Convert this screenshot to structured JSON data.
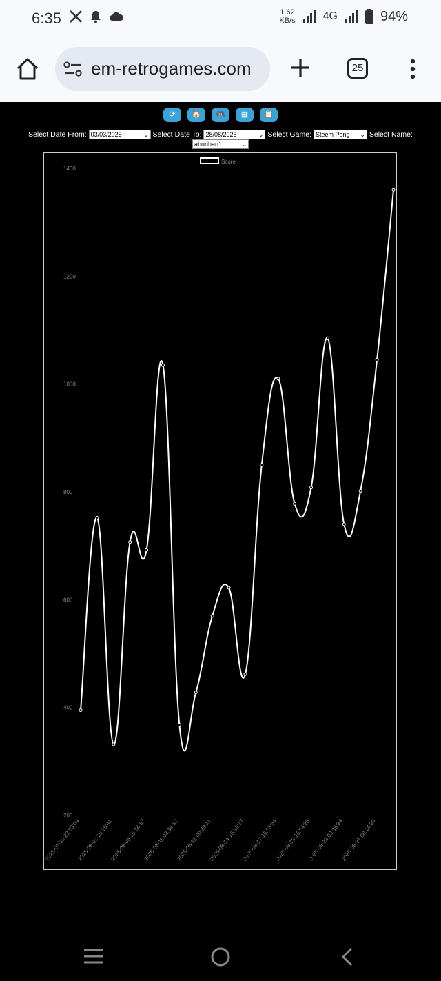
{
  "status_bar": {
    "time": "6:35",
    "net_speed": "1.62",
    "net_unit": "KB/s",
    "network": "4G",
    "battery": "94%"
  },
  "browser": {
    "url": "em-retrogames.com",
    "tab_count": "25"
  },
  "nav_buttons": [
    {
      "icon": "refresh-icon",
      "glyph": "⟳"
    },
    {
      "icon": "home-icon",
      "glyph": "🏠"
    },
    {
      "icon": "gamepad-icon",
      "glyph": "🎮"
    },
    {
      "icon": "grid-icon",
      "glyph": "▦"
    },
    {
      "icon": "clipboard-icon",
      "glyph": "📋"
    }
  ],
  "filters": {
    "date_from_label": "Select Date From:",
    "date_from_value": "03/03/2025",
    "date_to_label": "Select Date To:",
    "date_to_value": "28/08/2025",
    "game_label": "Select Game:",
    "game_value": "Steem Pong",
    "name_label": "Select Name:",
    "name_value": "aburihan1"
  },
  "colors": {
    "button": "#3aa3d8",
    "line": "#ffffff",
    "background": "#000000"
  },
  "chart_data": {
    "type": "line",
    "legend": "Score",
    "ylim": [
      200,
      1400
    ],
    "yticks": [
      200,
      400,
      600,
      800,
      1000,
      1200,
      1400
    ],
    "xticks": [
      "2025-07-30 22:53:04",
      "2025-08-02 15:15:41",
      "2025-08-05 15:24:57",
      "2025-08-11 02:34:52",
      "2025-08-12 00:29:11",
      "2025-08-14 15:12:17",
      "2025-08-17 15:53:54",
      "2025-08-19 15:54:28",
      "2025-08-23 03:35:34",
      "2025-08-27 08:14:30"
    ],
    "series": [
      {
        "name": "Score",
        "values": [
          395,
          752,
          332,
          707,
          692,
          1035,
          368,
          428,
          570,
          622,
          462,
          850,
          1010,
          778,
          808,
          1085,
          740,
          802,
          1045,
          1360
        ]
      }
    ]
  }
}
